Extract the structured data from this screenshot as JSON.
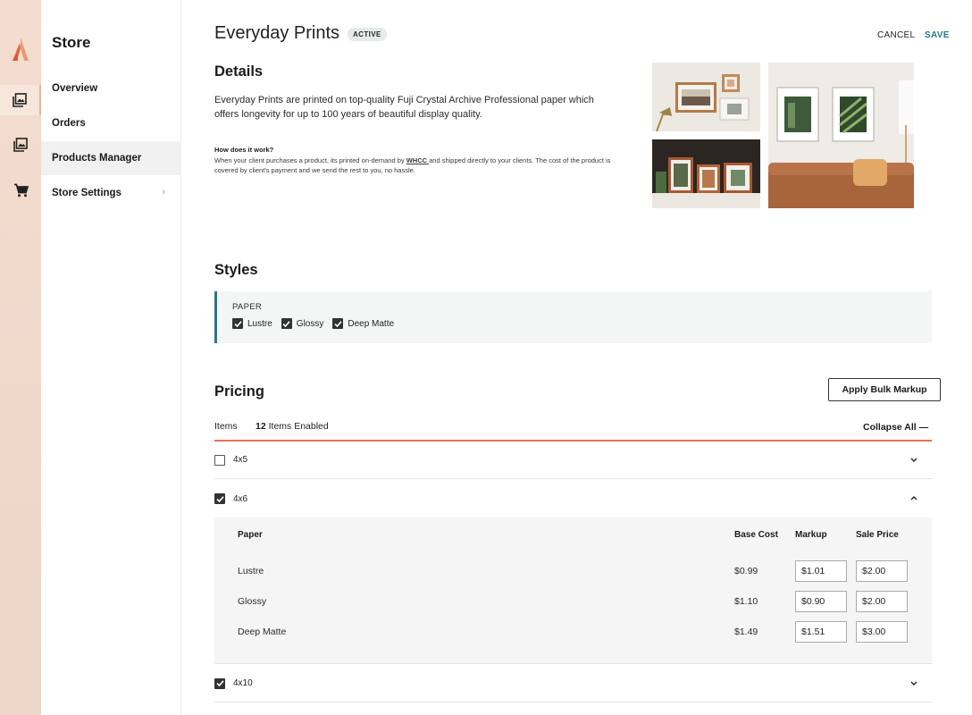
{
  "rail": {
    "items": [
      {
        "icon": "logo-icon"
      },
      {
        "icon": "photos-icon",
        "active": true
      },
      {
        "icon": "gallery-icon"
      },
      {
        "icon": "cart-icon"
      }
    ]
  },
  "subnav": {
    "title": "Store",
    "items": [
      {
        "label": "Overview"
      },
      {
        "label": "Orders"
      },
      {
        "label": "Products Manager"
      },
      {
        "label": "Store Settings"
      }
    ],
    "chevron": "›"
  },
  "header": {
    "title": "Everyday Prints",
    "badge": "ACTIVE",
    "cancel": "CANCEL",
    "save": "SAVE"
  },
  "details": {
    "heading": "Details",
    "body": "Everyday Prints are printed on top-quality Fuji Crystal Archive Professional paper which offers longevity for up to 100 years of beautiful display quality.",
    "how_title": "How does it work?",
    "how_pre": "When your client purchases a product, its printed on-demand by ",
    "how_link": "WHCC ",
    "how_post": "and shipped directly to your clients. The cost of the product is covered by client's payment and we send the rest to you, no hassle."
  },
  "styles": {
    "heading": "Styles",
    "group_label": "PAPER",
    "options": [
      {
        "label": "Lustre",
        "checked": true
      },
      {
        "label": "Glossy",
        "checked": true
      },
      {
        "label": "Deep Matte",
        "checked": true
      }
    ]
  },
  "pricing": {
    "heading": "Pricing",
    "bulk_button": "Apply Bulk Markup",
    "items_label": "Items",
    "enabled_count": "12",
    "enabled_suffix": " Items Enabled",
    "collapse_all": "Collapse All —",
    "rows": [
      {
        "size": "4x5",
        "checked": false,
        "expanded": false
      },
      {
        "size": "4x6",
        "checked": true,
        "expanded": true
      },
      {
        "size": "4x10",
        "checked": true,
        "expanded": false
      }
    ],
    "table": {
      "headers": {
        "paper": "Paper",
        "base": "Base Cost",
        "markup": "Markup",
        "sale": "Sale Price"
      },
      "rows": [
        {
          "paper": "Lustre",
          "base": "$0.99",
          "markup": "$1.01",
          "sale": "$2.00"
        },
        {
          "paper": "Glossy",
          "base": "$1.10",
          "markup": "$0.90",
          "sale": "$2.00"
        },
        {
          "paper": "Deep Matte",
          "base": "$1.49",
          "markup": "$1.51",
          "sale": "$3.00"
        }
      ]
    }
  },
  "colors": {
    "accent": "#1f7a8c",
    "brand": "#e0663f",
    "divider": "#e76d5a"
  }
}
